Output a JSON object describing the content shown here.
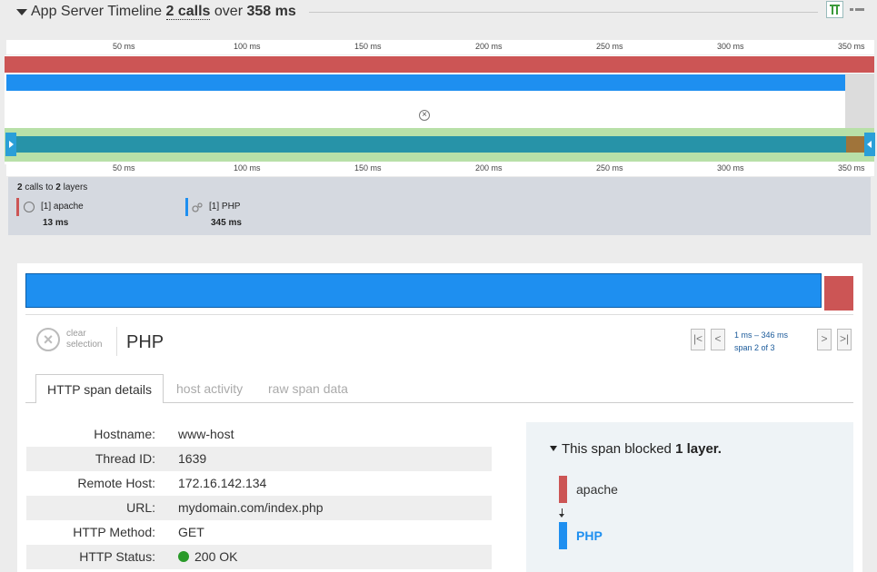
{
  "header": {
    "title_prefix": "App Server Timeline",
    "calls": "2 calls",
    "over": "over",
    "duration": "358 ms",
    "icons": [
      "timeline-view-icon",
      "list-view-icon"
    ]
  },
  "ruler": {
    "ticks": [
      "50 ms",
      "100 ms",
      "150 ms",
      "200 ms",
      "250 ms",
      "300 ms",
      "350 ms"
    ]
  },
  "colors": {
    "apache": "#cc5555",
    "php": "#1e8ff0",
    "minimap": "#2793a8",
    "ok": "#2a9a2a"
  },
  "legend": {
    "summary_count": "2",
    "summary_mid": "calls to",
    "summary_layers": "2",
    "summary_end": "layers",
    "items": [
      {
        "name": "[1] apache",
        "value": "13 ms",
        "icon": "globe-icon"
      },
      {
        "name": "[1] PHP",
        "value": "345 ms",
        "icon": "gears-icon"
      }
    ]
  },
  "detail": {
    "clear_line1": "clear",
    "clear_line2": "selection",
    "span_name": "PHP",
    "nav": [
      "|<",
      "<",
      ">",
      ">|"
    ],
    "range": "1 ms – 346 ms",
    "span_pos": "span 2 of 3",
    "tabs": [
      "HTTP span details",
      "host activity",
      "raw span data"
    ],
    "rows": [
      {
        "k": "Hostname:",
        "v": "www-host"
      },
      {
        "k": "Thread ID:",
        "v": "1639"
      },
      {
        "k": "Remote Host:",
        "v": "172.16.142.134"
      },
      {
        "k": "URL:",
        "v": "mydomain.com/index.php"
      },
      {
        "k": "HTTP Method:",
        "v": "GET"
      },
      {
        "k": "HTTP Status:",
        "v": "200 OK"
      }
    ],
    "blocked_prefix": "This span blocked",
    "blocked_count": "1 layer.",
    "blocked_layers": [
      "apache",
      "PHP"
    ]
  }
}
